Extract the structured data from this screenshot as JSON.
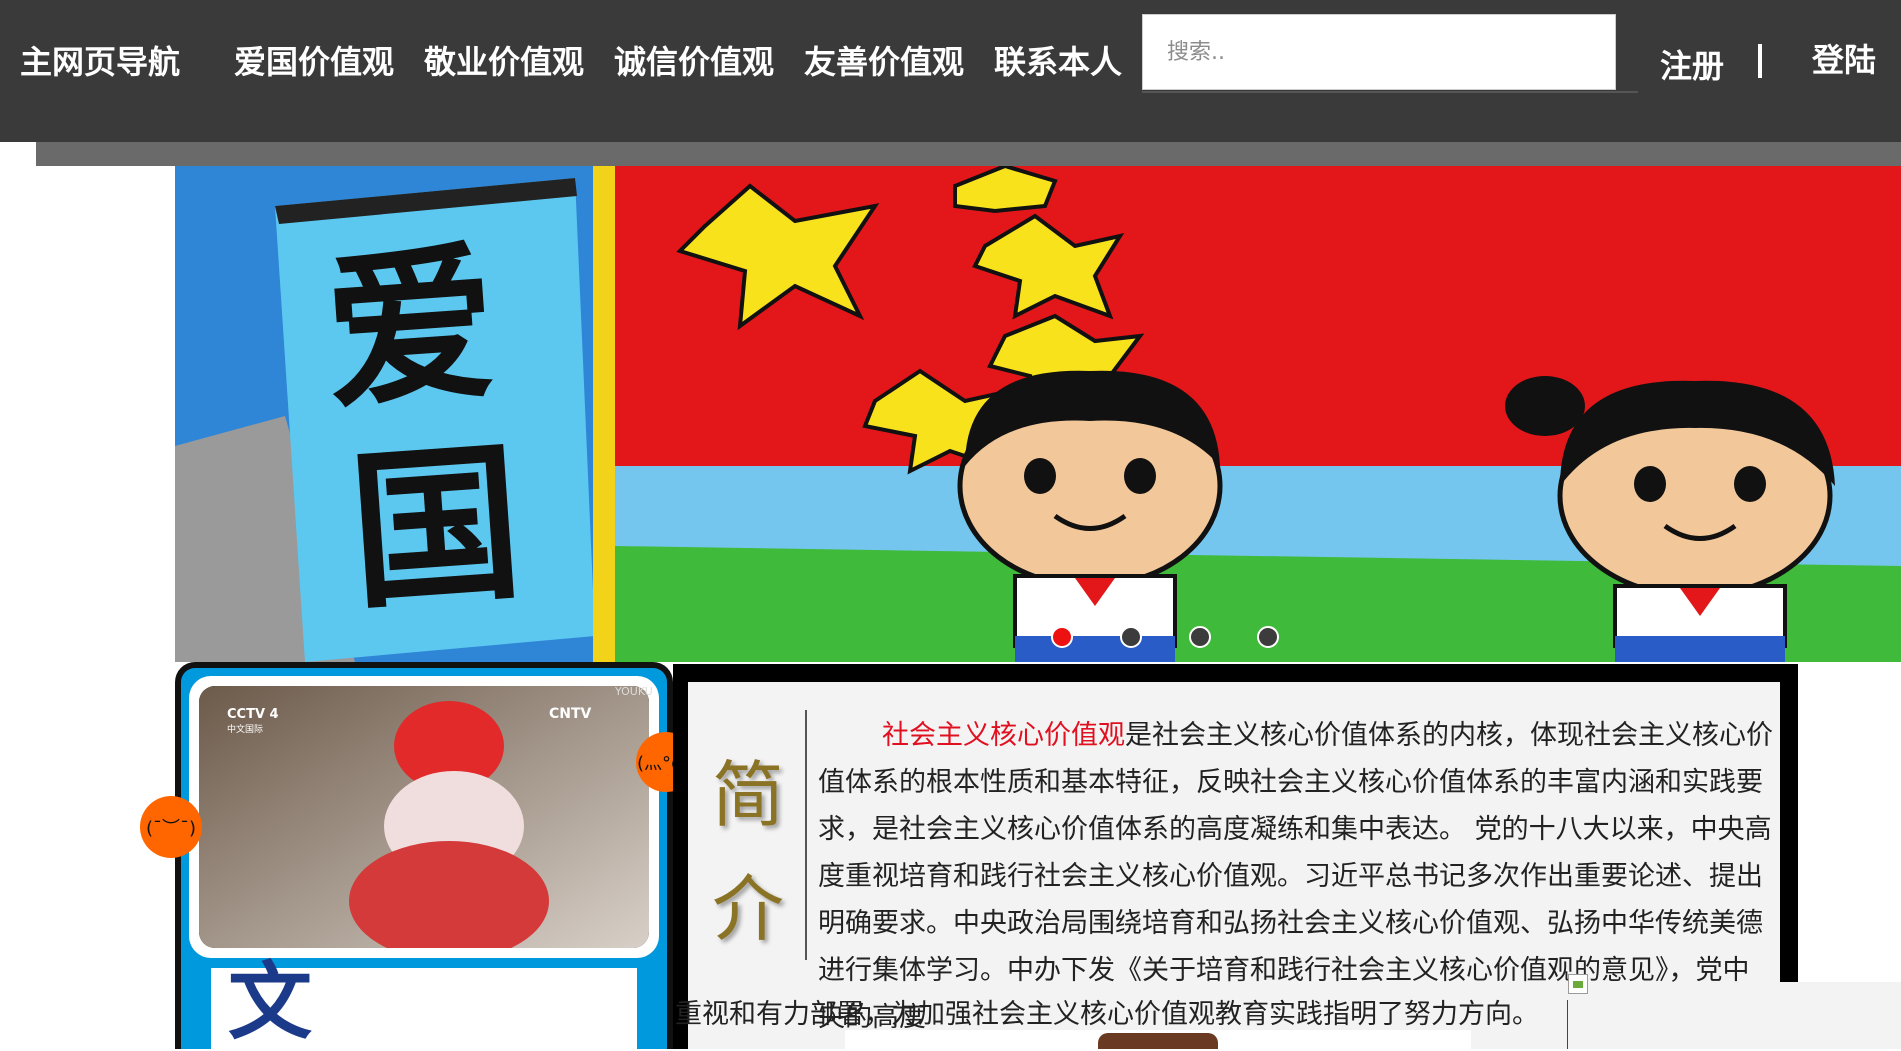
{
  "nav": {
    "items": [
      {
        "label": "主网页导航"
      },
      {
        "label": "爱国价值观"
      },
      {
        "label": "敬业价值观"
      },
      {
        "label": "诚信价值观"
      },
      {
        "label": "友善价值观"
      },
      {
        "label": "联系本人"
      }
    ],
    "search_placeholder": "搜索..",
    "register_label": "注册",
    "login_label": "登陆"
  },
  "banner": {
    "painted_text": [
      "爱",
      "国"
    ],
    "dots_count": 4,
    "active_dot": 1
  },
  "video": {
    "logo_text": "CCTV 4",
    "logo_sub": "中文国际",
    "corner_logo": "CNTV",
    "watermark": "YOUKU"
  },
  "card": {
    "char": "文"
  },
  "bubbles": {
    "left": "(¯︶¯)",
    "right": "(灬°ω°"
  },
  "intro": {
    "title": "简\n介",
    "highlight": "社会主义核心价值观",
    "text": "是社会主义核心价值体系的内核，体现社会主义核心价值体系的根本性质和基本特征，反映社会主义核心价值体系的丰富内涵和实践要求，是社会主义核心价值体系的高度凝练和集中表达。 党的十八大以来，中央高度重视培育和践行社会主义核心价值观。习近平总书记多次作出重要论述、提出明确要求。中央政治局围绕培育和弘扬社会主义核心价值观、弘扬中华传统美德进行集体学习。中办下发《关于培育和践行社会主义核心价值观的意见》，党中央的高度",
    "last_line": "重视和有力部署，为加强社会主义核心价值观教育实践指明了努力方向。"
  },
  "colors": {
    "topbar": "#3a3a3a",
    "accent_red": "#e01020",
    "card_blue": "#0099dd",
    "bubble_orange": "#ff6600",
    "title_gold": "#8b7325"
  }
}
